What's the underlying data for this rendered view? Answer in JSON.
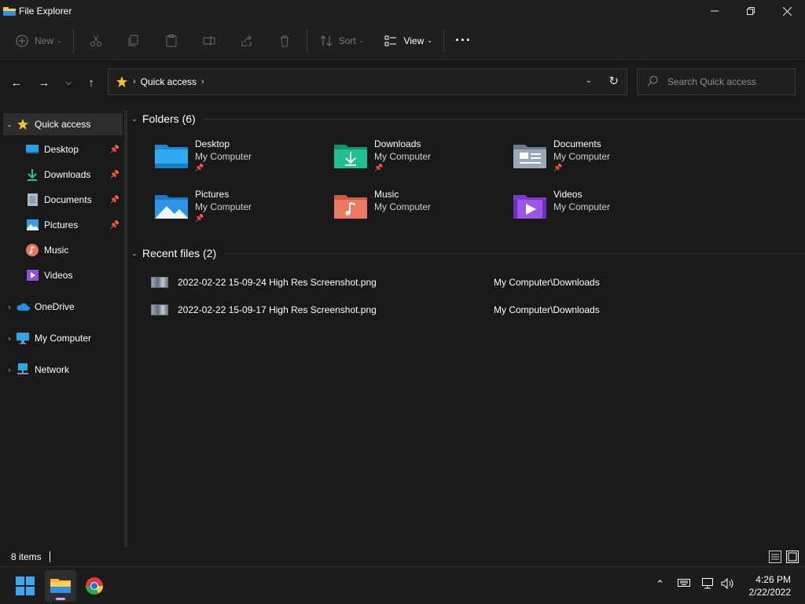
{
  "window": {
    "title": "File Explorer"
  },
  "titlebar_controls": [
    "minimize-icon",
    "restore-icon",
    "close-icon"
  ],
  "toolbar": {
    "new_label": "New",
    "sort_label": "Sort",
    "view_label": "View",
    "more": "···",
    "disabled_icons": [
      "cut-icon",
      "copy-icon",
      "paste-icon",
      "rename-icon",
      "share-icon",
      "delete-icon"
    ]
  },
  "address": {
    "location": "Quick access",
    "location_icon": "star-icon"
  },
  "search": {
    "placeholder": "Search Quick access"
  },
  "sidebar": {
    "items": [
      {
        "label": "Quick access",
        "icon": "star-icon",
        "expanded": true,
        "selected": true
      },
      {
        "label": "Desktop",
        "icon": "desktop-icon",
        "pinned": true
      },
      {
        "label": "Downloads",
        "icon": "download-icon",
        "pinned": true
      },
      {
        "label": "Documents",
        "icon": "documents-icon",
        "pinned": true
      },
      {
        "label": "Pictures",
        "icon": "pictures-icon",
        "pinned": true
      },
      {
        "label": "Music",
        "icon": "music-icon"
      },
      {
        "label": "Videos",
        "icon": "videos-icon"
      },
      {
        "label": "OneDrive",
        "icon": "cloud-icon"
      },
      {
        "label": "My Computer",
        "icon": "computer-icon"
      },
      {
        "label": "Network",
        "icon": "network-icon"
      }
    ]
  },
  "folders": {
    "header": "Folders (6)",
    "items": [
      {
        "name": "Desktop",
        "location": "My Computer",
        "pinned": true,
        "icon": "desktop-folder-icon",
        "color": "#1f9fe8"
      },
      {
        "name": "Downloads",
        "location": "My Computer",
        "pinned": true,
        "icon": "downloads-folder-icon",
        "color": "#1fb58f"
      },
      {
        "name": "Documents",
        "location": "My Computer",
        "pinned": true,
        "icon": "documents-folder-icon",
        "color": "#8c9bb0"
      },
      {
        "name": "Pictures",
        "location": "My Computer",
        "pinned": true,
        "icon": "pictures-folder-icon",
        "color": "#2c8fe0"
      },
      {
        "name": "Music",
        "location": "My Computer",
        "pinned": false,
        "icon": "music-folder-icon",
        "color": "#e8745a"
      },
      {
        "name": "Videos",
        "location": "My Computer",
        "pinned": false,
        "icon": "videos-folder-icon",
        "color": "#9a4fe0"
      }
    ]
  },
  "recent": {
    "header": "Recent files (2)",
    "items": [
      {
        "name": "2022-02-22 15-09-24 High Res Screenshot.png",
        "path": "My Computer\\Downloads"
      },
      {
        "name": "2022-02-22 15-09-17 High Res Screenshot.png",
        "path": "My Computer\\Downloads"
      }
    ]
  },
  "status": {
    "count": "8 items"
  },
  "taskbar": {
    "apps": [
      "start-icon",
      "file-explorer-icon",
      "chrome-icon"
    ],
    "time": "4:26 PM",
    "date": "2/22/2022"
  }
}
